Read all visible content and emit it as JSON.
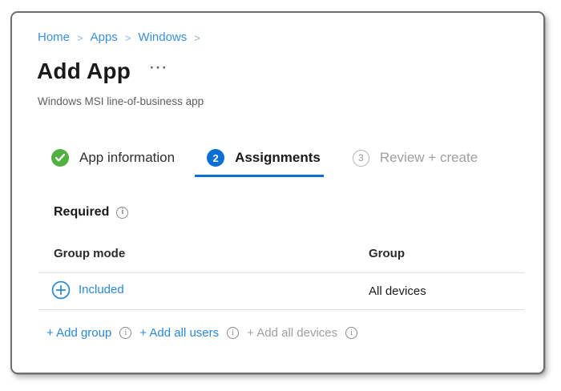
{
  "breadcrumb": {
    "separator": ">",
    "items": [
      {
        "label": "Home"
      },
      {
        "label": "Apps"
      },
      {
        "label": "Windows"
      }
    ]
  },
  "header": {
    "title": "Add App",
    "more_options": "···",
    "subtitle": "Windows MSI line-of-business app"
  },
  "wizard": {
    "steps": [
      {
        "label": "App information",
        "state": "completed",
        "icon": "checkmark-icon"
      },
      {
        "label": "Assignments",
        "number": "2",
        "state": "active"
      },
      {
        "label": "Review + create",
        "number": "3",
        "state": "upcoming"
      }
    ]
  },
  "assignments": {
    "section_heading": "Required",
    "table": {
      "columns": [
        {
          "label": "Group mode"
        },
        {
          "label": "Group"
        }
      ],
      "rows": [
        {
          "group_mode": "Included",
          "group": "All devices",
          "icon": "plus-circle-icon"
        }
      ]
    },
    "actions": [
      {
        "label": "+ Add group",
        "enabled": true
      },
      {
        "label": "+ Add all users",
        "enabled": true
      },
      {
        "label": "+ Add all devices",
        "enabled": false
      }
    ]
  },
  "colors": {
    "accent_blue": "#0b6fd4",
    "link_blue": "#2b88d8",
    "breadcrumb_blue": "#3990e0",
    "success_green": "#52b043",
    "text_dark": "#1b1a19",
    "text_muted": "#605e5c",
    "text_disabled": "#a19f9d",
    "divider": "#e3e1df",
    "frame_border": "#6e6e6e",
    "info_gray": "#8a8886"
  }
}
